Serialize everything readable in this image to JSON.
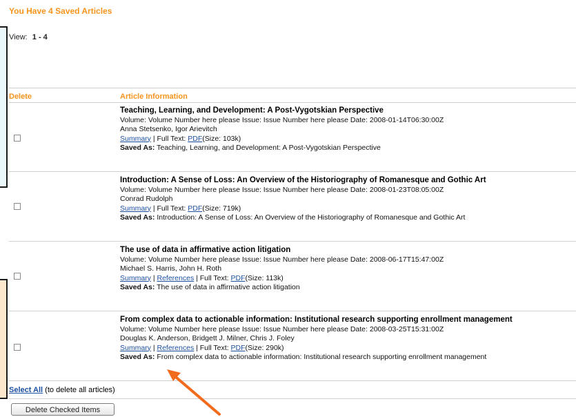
{
  "heading": "You Have 4 Saved Articles",
  "view": {
    "label": "View:",
    "range": "1 - 4"
  },
  "columns": {
    "delete": "Delete",
    "info": "Article Information"
  },
  "articles": [
    {
      "title": "Teaching, Learning, and Development: A Post-Vygotskian Perspective",
      "meta": "Volume: Volume Number here please Issue: Issue Number here please Date: 2008-01-14T06:30:00Z",
      "authors": "Anna Stetsenko, Igor Arievitch",
      "summary": "Summary",
      "references": "",
      "fulltext": "| Full Text:",
      "pdf": "PDF",
      "size": "(Size: 103k)",
      "saved_label": "Saved As:",
      "saved_as": "Teaching, Learning, and Development: A Post-Vygotskian Perspective"
    },
    {
      "title": "Introduction: A Sense of Loss: An Overview of the Historiography of Romanesque and Gothic Art",
      "meta": "Volume: Volume Number here please Issue: Issue Number here please Date: 2008-01-23T08:05:00Z",
      "authors": "Conrad Rudolph",
      "summary": "Summary",
      "references": "",
      "fulltext": "| Full Text:",
      "pdf": "PDF",
      "size": "(Size: 719k)",
      "saved_label": "Saved As:",
      "saved_as": "Introduction: A Sense of Loss: An Overview of the Historiography of Romanesque and Gothic Art"
    },
    {
      "title": "The use of data in affirmative action litigation",
      "meta": "Volume: Volume Number here please Issue: Issue Number here please Date: 2008-06-17T15:47:00Z",
      "authors": "Michael S. Harris, John H. Roth",
      "summary": "Summary",
      "references": "References",
      "fulltext": "| Full Text:",
      "pdf": "PDF",
      "size": "(Size: 113k)",
      "saved_label": "Saved As:",
      "saved_as": "The use of data in affirmative action litigation"
    },
    {
      "title": "From complex data to actionable information: Institutional research supporting enrollment management",
      "meta": "Volume: Volume Number here please Issue: Issue Number here please Date: 2008-03-25T15:31:00Z",
      "authors": "Douglas K. Anderson, Bridgett J. Milner, Chris J. Foley",
      "summary": "Summary",
      "references": "References",
      "fulltext": "| Full Text:",
      "pdf": "PDF",
      "size": "(Size: 290k)",
      "saved_label": "Saved As:",
      "saved_as": "From complex data to actionable information: Institutional research supporting enrollment management"
    }
  ],
  "select_all": {
    "link": "Select All",
    "note": " (to delete all articles)"
  },
  "delete_button": "Delete Checked Items",
  "colors": {
    "accent": "#f7941d",
    "link": "#1c4fa0",
    "arrow": "#f26b1d"
  }
}
